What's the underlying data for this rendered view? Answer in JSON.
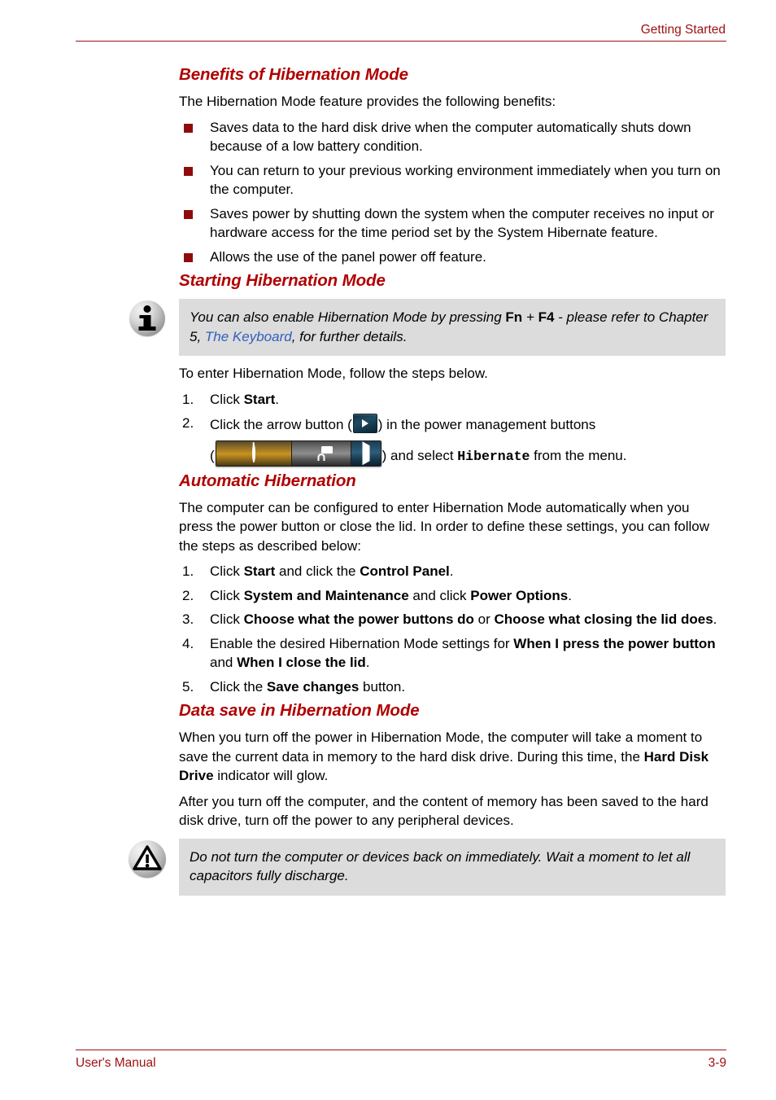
{
  "header": {
    "title": "Getting Started"
  },
  "sections": {
    "benefits": {
      "heading": "Benefits of Hibernation Mode",
      "intro": "The Hibernation Mode feature provides the following benefits:",
      "bullets": [
        "Saves data to the hard disk drive when the computer automatically shuts down because of a low battery condition.",
        "You can return to your previous working environment immediately when you turn on the computer.",
        "Saves power by shutting down the system when the computer receives no input or hardware access for the time period set by the System Hibernate feature.",
        "Allows the use of the panel power off feature."
      ]
    },
    "starting": {
      "heading": "Starting Hibernation Mode",
      "note": {
        "icon": "info-icon",
        "text_part1": "You can also enable Hibernation Mode by pressing ",
        "key1": "Fn",
        "plus": " + ",
        "key2": "F4",
        "text_part2": " - please refer to Chapter 5, ",
        "link": "The Keyboard",
        "text_part3": ", for further details."
      },
      "intro": "To enter Hibernation Mode, follow the steps below.",
      "steps": [
        {
          "number": "1.",
          "text_before": "Click ",
          "bold": "Start",
          "text_after": "."
        },
        {
          "number": "2.",
          "line1_before": "Click the arrow button (",
          "line1_after": ") in the power management buttons",
          "line2_open": "(",
          "line2_mid": ") and select ",
          "keyword": "Hibernate",
          "line2_end": " from the menu."
        }
      ]
    },
    "automatic": {
      "heading": "Automatic Hibernation",
      "intro": "The computer can be configured to enter Hibernation Mode automatically when you press the power button or close the lid. In order to define these settings, you can follow the steps as described below:",
      "steps": [
        {
          "number": "1.",
          "parts": [
            {
              "t": "Click ",
              "b": false
            },
            {
              "t": "Start",
              "b": true
            },
            {
              "t": " and click the ",
              "b": false
            },
            {
              "t": "Control Panel",
              "b": true
            },
            {
              "t": ".",
              "b": false
            }
          ]
        },
        {
          "number": "2.",
          "parts": [
            {
              "t": "Click ",
              "b": false
            },
            {
              "t": "System and Maintenance",
              "b": true
            },
            {
              "t": " and click ",
              "b": false
            },
            {
              "t": "Power Options",
              "b": true
            },
            {
              "t": ".",
              "b": false
            }
          ]
        },
        {
          "number": "3.",
          "parts": [
            {
              "t": "Click ",
              "b": false
            },
            {
              "t": "Choose what the power buttons do",
              "b": true
            },
            {
              "t": " or ",
              "b": false
            },
            {
              "t": "Choose what closing the lid does",
              "b": true
            },
            {
              "t": ".",
              "b": false
            }
          ]
        },
        {
          "number": "4.",
          "parts": [
            {
              "t": "Enable the desired Hibernation Mode settings for ",
              "b": false
            },
            {
              "t": "When I press the power button",
              "b": true
            },
            {
              "t": " and ",
              "b": false
            },
            {
              "t": "When I close the lid",
              "b": true
            },
            {
              "t": ".",
              "b": false
            }
          ]
        },
        {
          "number": "5.",
          "parts": [
            {
              "t": "Click the ",
              "b": false
            },
            {
              "t": "Save changes",
              "b": true
            },
            {
              "t": " button.",
              "b": false
            }
          ]
        }
      ]
    },
    "datasave": {
      "heading": "Data save in Hibernation Mode",
      "para1_before": "When you turn off the power in Hibernation Mode, the computer will take a moment to save the current data in memory to the hard disk drive. During this time, the ",
      "para1_bold": "Hard Disk Drive",
      "para1_after": " indicator will glow.",
      "para2": "After you turn off the computer, and the content of memory has been saved to the hard disk drive, turn off the power to any peripheral devices.",
      "warning": {
        "icon": "warning-icon",
        "text": "Do not turn the computer or devices back on immediately. Wait a moment to let all capacitors fully discharge."
      }
    }
  },
  "footer": {
    "left": "User's Manual",
    "right": "3-9"
  },
  "colors": {
    "accent_red": "#9e1010",
    "heading_red": "#b00000",
    "bullet_red": "#8f0b0b",
    "link_blue": "#2f5fc0",
    "note_bg": "#dcdcdc"
  }
}
